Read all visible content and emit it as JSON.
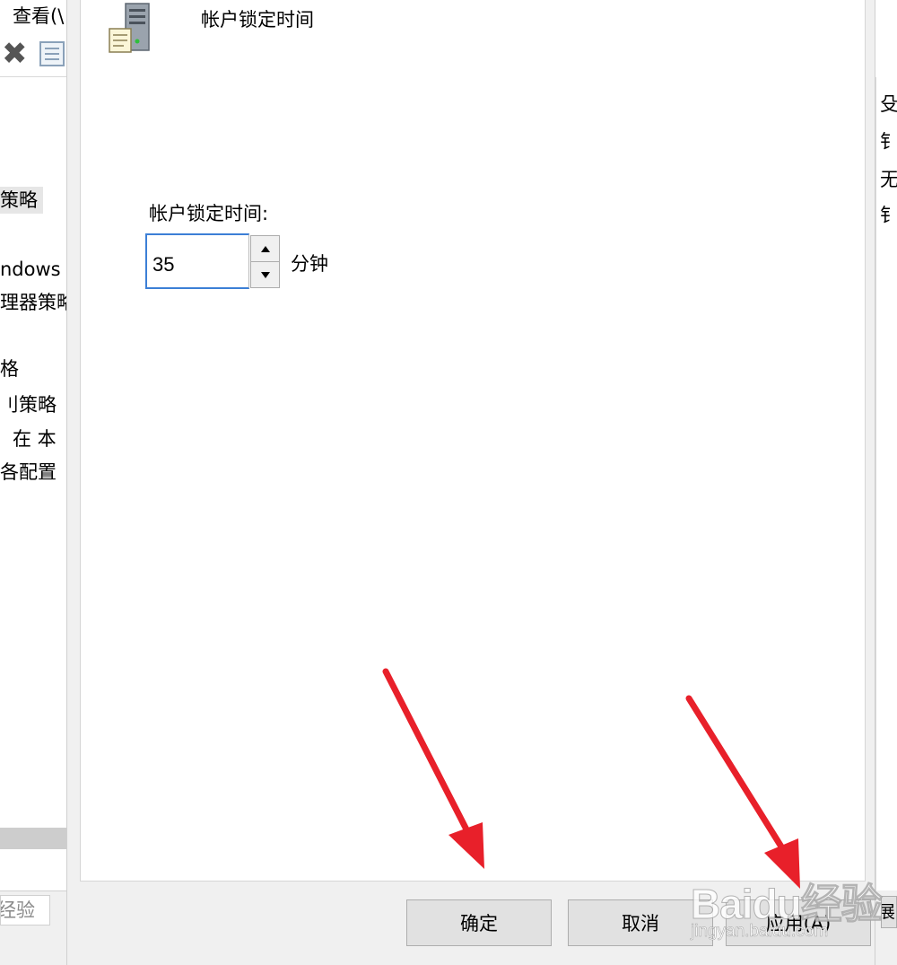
{
  "background_window": {
    "menu_partial": "查看(\\",
    "tree_items": [
      "策略",
      "ndows",
      "理器策略",
      "格",
      "刂策略",
      "在 本",
      "各配置"
    ],
    "right_items": [
      "殳",
      "钅",
      "无",
      "钅"
    ],
    "status_partial": "经验",
    "right_button_partial": "展"
  },
  "dialog": {
    "policy_title": "帐户锁定时间",
    "field_label": "帐户锁定时间:",
    "field_value": "35",
    "unit_label": "分钟",
    "buttons": {
      "ok": "确定",
      "cancel": "取消",
      "apply": "应用(A)"
    }
  },
  "watermark": {
    "brand": "Baidu经验",
    "url": "jingyan.baidu.com"
  },
  "colors": {
    "arrow": "#e8202a",
    "focus_border": "#3c7fd6",
    "dialog_bg": "#f0f0f0"
  }
}
